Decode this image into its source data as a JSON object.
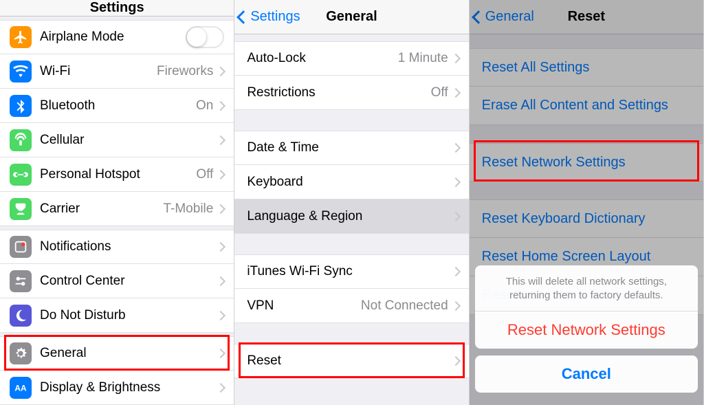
{
  "panel1": {
    "title": "Settings",
    "groups": [
      {
        "items": [
          {
            "icon": "airplane",
            "bg": "#ff9500",
            "label": "Airplane Mode",
            "type": "toggle",
            "on": false
          },
          {
            "icon": "wifi",
            "bg": "#007aff",
            "label": "Wi-Fi",
            "value": "Fireworks",
            "type": "nav"
          },
          {
            "icon": "bluetooth",
            "bg": "#007aff",
            "label": "Bluetooth",
            "value": "On",
            "type": "nav"
          },
          {
            "icon": "cellular",
            "bg": "#4cd964",
            "label": "Cellular",
            "type": "nav"
          },
          {
            "icon": "hotspot",
            "bg": "#4cd964",
            "label": "Personal Hotspot",
            "value": "Off",
            "type": "nav"
          },
          {
            "icon": "carrier",
            "bg": "#4cd964",
            "label": "Carrier",
            "value": "T-Mobile",
            "type": "nav"
          }
        ]
      },
      {
        "items": [
          {
            "icon": "notifications",
            "bg": "#8e8e93",
            "label": "Notifications",
            "type": "nav"
          },
          {
            "icon": "controlcenter",
            "bg": "#8e8e93",
            "label": "Control Center",
            "type": "nav"
          },
          {
            "icon": "dnd",
            "bg": "#5856d6",
            "label": "Do Not Disturb",
            "type": "nav"
          }
        ]
      },
      {
        "items": [
          {
            "icon": "general",
            "bg": "#8e8e93",
            "label": "General",
            "type": "nav",
            "highlight": true
          },
          {
            "icon": "display",
            "bg": "#007aff",
            "label": "Display & Brightness",
            "type": "nav"
          }
        ]
      }
    ]
  },
  "panel2": {
    "back": "Settings",
    "title": "General",
    "groups": [
      {
        "items": [
          {
            "label": "Auto-Lock",
            "value": "1 Minute",
            "type": "nav"
          },
          {
            "label": "Restrictions",
            "value": "Off",
            "type": "nav"
          }
        ]
      },
      {
        "items": [
          {
            "label": "Date & Time",
            "type": "nav"
          },
          {
            "label": "Keyboard",
            "type": "nav"
          },
          {
            "label": "Language & Region",
            "type": "nav",
            "selected": true
          }
        ]
      },
      {
        "items": [
          {
            "label": "iTunes Wi-Fi Sync",
            "type": "nav"
          },
          {
            "label": "VPN",
            "value": "Not Connected",
            "type": "nav"
          }
        ]
      },
      {
        "items": [
          {
            "label": "Reset",
            "type": "nav",
            "highlight": true
          }
        ]
      }
    ]
  },
  "panel3": {
    "back": "General",
    "title": "Reset",
    "groups": [
      {
        "items": [
          {
            "label": "Reset All Settings"
          },
          {
            "label": "Erase All Content and Settings"
          }
        ]
      },
      {
        "items": [
          {
            "label": "Reset Network Settings",
            "highlight": true
          }
        ]
      },
      {
        "items": [
          {
            "label": "Reset Keyboard Dictionary"
          },
          {
            "label": "Reset Home Screen Layout"
          },
          {
            "label": "Reset Location & Privacy"
          }
        ]
      }
    ],
    "sheet": {
      "message": "This will delete all network settings, returning them to factory defaults.",
      "destructive": "Reset Network Settings",
      "cancel": "Cancel"
    }
  }
}
